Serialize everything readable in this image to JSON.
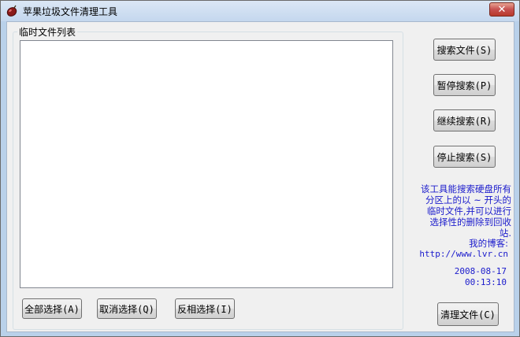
{
  "window": {
    "title": "苹果垃圾文件清理工具",
    "close_symbol": "✕"
  },
  "group": {
    "label": "临时文件列表"
  },
  "buttons": {
    "search": "搜索文件(S)",
    "pause": "暂停搜索(P)",
    "resume": "继续搜索(R)",
    "stop": "停止搜索(S)",
    "select_all": "全部选择(A)",
    "deselect": "取消选择(Q)",
    "invert": "反相选择(I)",
    "clean": "清理文件(C)"
  },
  "info": {
    "description": "该工具能搜索硬盘所有分区上的以 ~ 开头的临时文件,并可以进行选择性的删除到回收站.",
    "blog_label": "我的博客:",
    "blog_url": "http://www.lvr.cn",
    "date": "2008-08-17",
    "time": "00:13:10"
  },
  "colors": {
    "info_text": "#1a1acc",
    "title_bar": "#c4d7ee",
    "close_button": "#c75050"
  },
  "icons": {
    "app": "apple-icon",
    "close": "close-icon"
  }
}
